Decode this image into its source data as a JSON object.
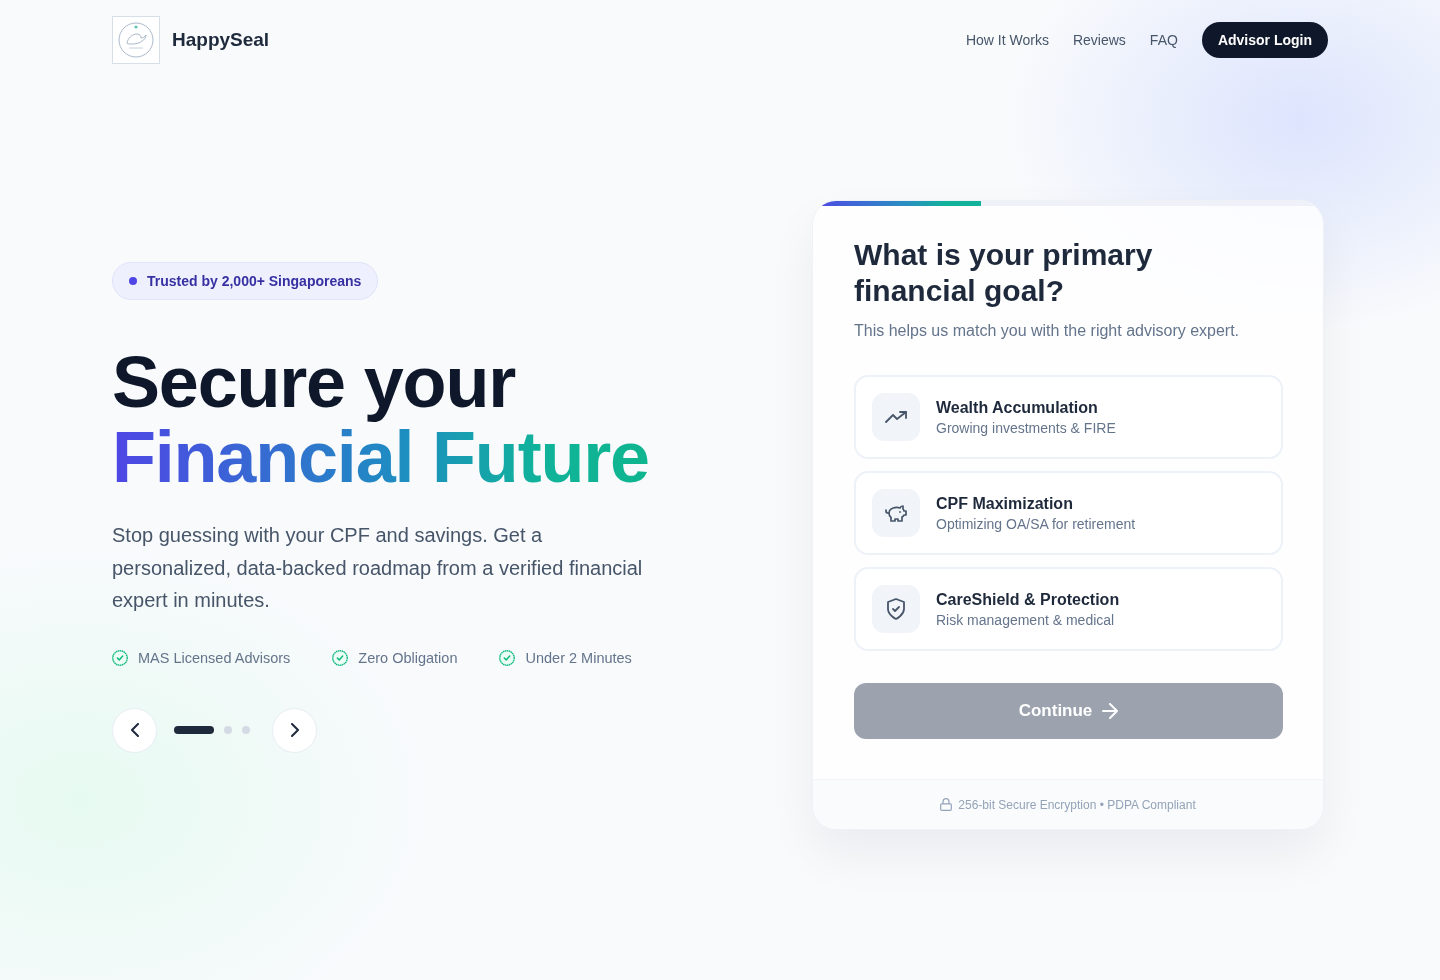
{
  "header": {
    "brand": "HappySeal",
    "nav_links": [
      "How It Works",
      "Reviews",
      "FAQ"
    ],
    "login_button": "Advisor Login"
  },
  "hero": {
    "badge": "Trusted by 2,000+ Singaporeans",
    "headline": "Secure your",
    "headline_highlight": "Financial Future",
    "description": "Stop guessing with your CPF and savings. Get a personalized, data-backed roadmap from a verified financial expert in minutes.",
    "features": [
      "MAS Licensed Advisors",
      "Zero Obligation",
      "Under 2 Minutes"
    ],
    "carousel": {
      "dots": [
        {
          "selected": true
        },
        {
          "selected": false
        },
        {
          "selected": false
        }
      ]
    }
  },
  "quiz_card": {
    "progress": {
      "level": 0.33
    },
    "question": "What is your primary financial goal?",
    "subtitle": "This helps us match you with the right advisory expert.",
    "options": [
      {
        "title": "Wealth Accumulation",
        "description": "Growing investments & FIRE",
        "selected": false
      },
      {
        "title": "CPF Maximization",
        "description": "Optimizing OA/SA for retirement",
        "selected": false
      },
      {
        "title": "CareShield & Protection",
        "description": "Risk management & medical",
        "selected": false
      }
    ],
    "continue_button": {
      "label": "Continue",
      "disabled": true
    },
    "footer_note": "256-bit Secure Encryption • PDPA Compliant"
  }
}
